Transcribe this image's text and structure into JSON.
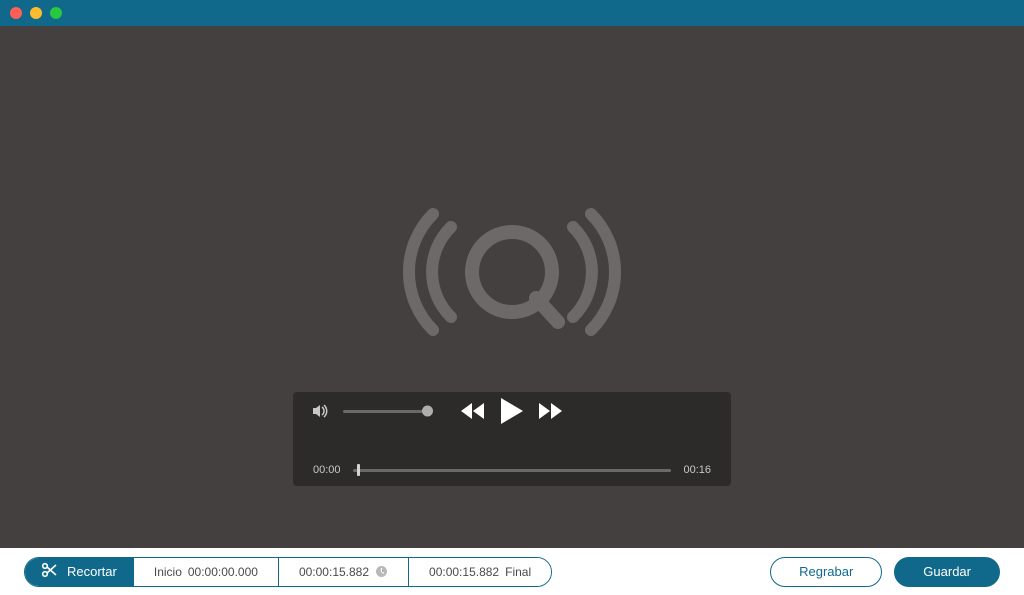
{
  "colors": {
    "accent": "#10698b",
    "trafficRed": "#ff5f57",
    "trafficYellow": "#febc2e",
    "trafficGreen": "#28c840"
  },
  "player": {
    "currentTime": "00:00",
    "totalTime": "00:16",
    "volumePercent": 100,
    "seekPercent": 2
  },
  "trim": {
    "buttonLabel": "Recortar",
    "startLabel": "Inicio",
    "startTime": "00:00:00.000",
    "currentTime": "00:00:15.882",
    "endTime": "00:00:15.882",
    "endLabel": "Final"
  },
  "actions": {
    "rerecord": "Regrabar",
    "save": "Guardar"
  }
}
